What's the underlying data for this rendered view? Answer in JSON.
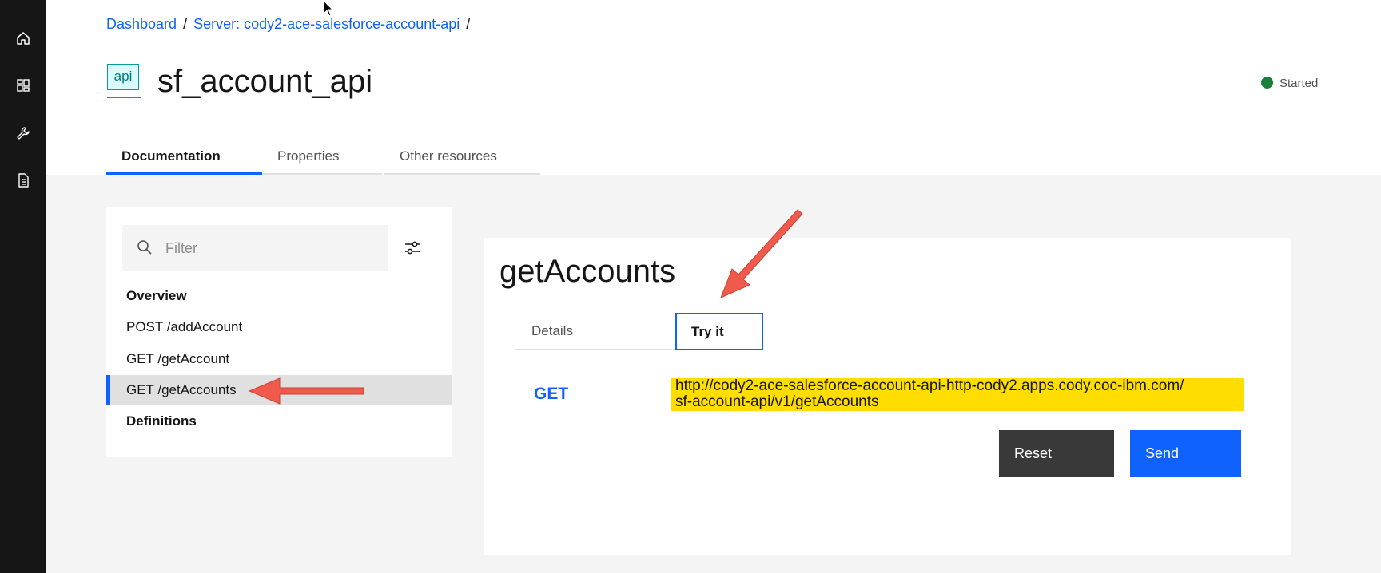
{
  "breadcrumb": {
    "items": [
      "Dashboard",
      "Server: cody2-ace-salesforce-account-api"
    ],
    "separator": "/"
  },
  "header": {
    "icon_text": "api",
    "title": "sf_account_api",
    "status": "Started",
    "status_color": "#198038"
  },
  "tabs": [
    "Documentation",
    "Properties",
    "Other resources"
  ],
  "sidebar": {
    "filter_placeholder": "Filter",
    "items": [
      "Overview",
      "POST /addAccount",
      "GET /getAccount",
      "GET /getAccounts",
      "Definitions"
    ],
    "selected": "GET /getAccounts"
  },
  "operation": {
    "title": "getAccounts",
    "tabs": [
      "Details",
      "Try it"
    ],
    "active_tab": "Try it",
    "method": "GET",
    "url_line1": "http://cody2-ace-salesforce-account-api-http-cody2.apps.cody.coc-ibm.com/",
    "url_line2": "sf-account-api/v1/getAccounts",
    "reset_label": "Reset",
    "send_label": "Send"
  },
  "rail": {
    "icons": [
      "home-icon",
      "dashboard-icon",
      "tools-icon",
      "document-icon"
    ]
  },
  "colors": {
    "accent": "#0f62fe",
    "highlight": "#ffdd00",
    "annotation_arrow": "#ef5a4c"
  }
}
